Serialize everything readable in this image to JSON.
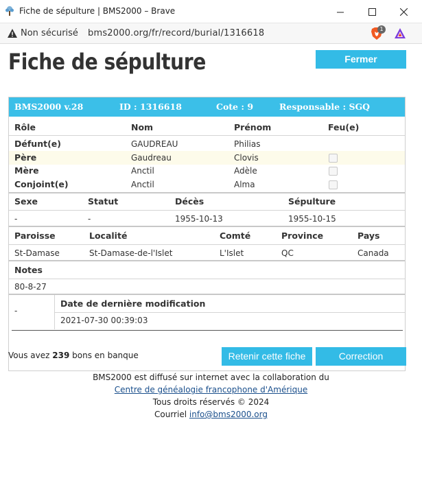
{
  "window": {
    "title": "Fiche de sépulture | BMS2000 – Brave"
  },
  "address_bar": {
    "security": "Non sécurisé",
    "url": "bms2000.org/fr/record/burial/1316618",
    "shields_count": "1"
  },
  "page": {
    "title": "Fiche de sépulture",
    "close_label": "Fermer"
  },
  "record": {
    "header": {
      "version": "BMS2000 v.28",
      "id": "ID : 1316618",
      "cote": "Cote : 9",
      "responsable": "Responsable : SGQ"
    },
    "persons_columns": [
      "Rôle",
      "Nom",
      "Prénom",
      "Feu(e)"
    ],
    "persons": [
      {
        "role": "Défunt(e)",
        "nom": "GAUDREAU",
        "prenom": "Philias",
        "feu": null
      },
      {
        "role": "Père",
        "nom": "Gaudreau",
        "prenom": "Clovis",
        "feu": false
      },
      {
        "role": "Mère",
        "nom": "Anctil",
        "prenom": "Adèle",
        "feu": false
      },
      {
        "role": "Conjoint(e)",
        "nom": "Anctil",
        "prenom": "Alma",
        "feu": false
      }
    ],
    "details_columns": [
      "Sexe",
      "Statut",
      "Décès",
      "Sépulture"
    ],
    "details": {
      "sexe": "-",
      "statut": "-",
      "deces": "1955-10-13",
      "sepulture": "1955-10-15"
    },
    "place_columns": [
      "Paroisse",
      "Localité",
      "Comté",
      "Province",
      "Pays"
    ],
    "place": {
      "paroisse": "St-Damase",
      "localite": "St-Damase-de-l'Islet",
      "comte": "L'Islet",
      "province": "QC",
      "pays": "Canada"
    },
    "notes_label": "Notes",
    "notes": "80-8-27",
    "modification": {
      "left_value": "-",
      "label": "Date de dernière modification",
      "date": "2021-07-30 00:39:03"
    }
  },
  "bank": {
    "prefix": "Vous avez",
    "count": "239",
    "suffix": "bons en banque"
  },
  "actions": {
    "retain_label": "Retenir cette fiche",
    "correction_label": "Correction"
  },
  "footer": {
    "line1": "BMS2000 est diffusé sur internet avec la collaboration du",
    "link1": "Centre de généalogie francophone d'Amérique",
    "line3": "Tous droits réservés © 2024",
    "contact_prefix": "Courriel",
    "email": "info@bms2000.org"
  },
  "colors": {
    "accent": "#3bbfe8",
    "highlight_row": "#fdfbea"
  }
}
